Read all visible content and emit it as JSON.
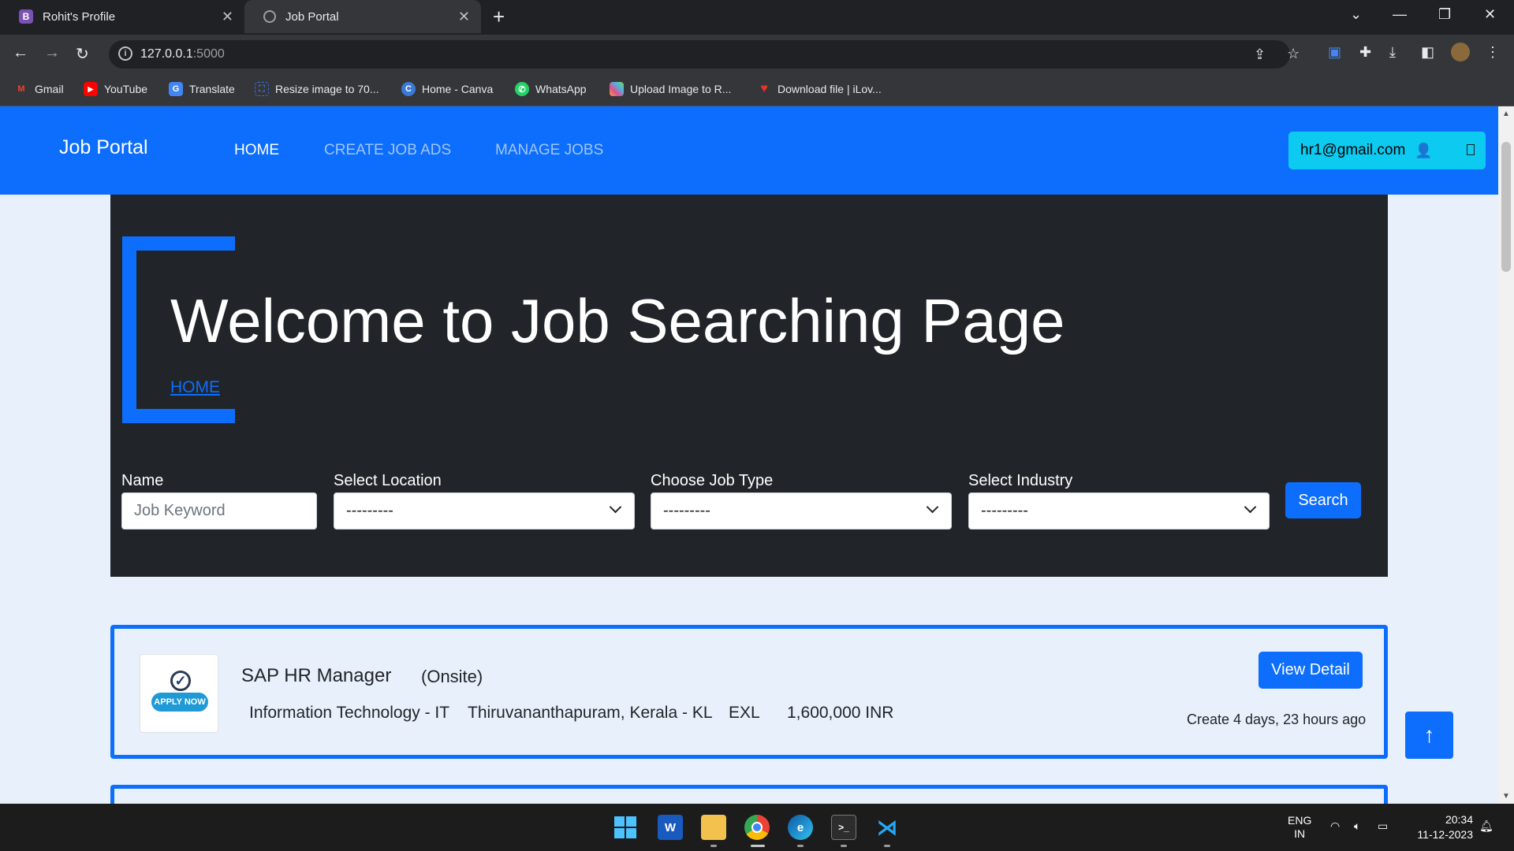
{
  "browser": {
    "tabs": [
      {
        "label": "Rohit's Profile",
        "favicon": "B"
      },
      {
        "label": "Job Portal"
      }
    ],
    "url_host": "127.0.0.1",
    "url_port": ":5000",
    "bookmarks": [
      {
        "label": "Gmail",
        "icon": "M",
        "color": "#ea4335"
      },
      {
        "label": "YouTube",
        "icon": "▶",
        "color": "#ff0000"
      },
      {
        "label": "Translate",
        "icon": "G",
        "color": "#4285f4"
      },
      {
        "label": "Resize image to 70...",
        "icon": "⛶",
        "color": "#3b6fd4"
      },
      {
        "label": "Home - Canva",
        "icon": "C",
        "color": "#3a7ad6"
      },
      {
        "label": "WhatsApp",
        "icon": "✆",
        "color": "#25d366"
      },
      {
        "label": "Upload Image to R...",
        "icon": "■",
        "color": "#f2a93b"
      },
      {
        "label": "Download file | iLov...",
        "icon": "♥",
        "color": "#e5322d"
      }
    ]
  },
  "navbar": {
    "brand": "Job Portal",
    "links": [
      "HOME",
      "CREATE JOB ADS",
      "MANAGE JOBS"
    ],
    "user": "hr1@gmail.com"
  },
  "hero": {
    "title": "Welcome to Job Searching Page",
    "breadcrumb": "HOME"
  },
  "search": {
    "name_label": "Name",
    "name_placeholder": "Job Keyword",
    "location_label": "Select Location",
    "location_value": "---------",
    "jobtype_label": "Choose Job Type",
    "jobtype_value": "---------",
    "industry_label": "Select Industry",
    "industry_value": "---------",
    "button": "Search"
  },
  "jobs": [
    {
      "logo_text": "APPLY NOW",
      "title": "SAP HR Manager",
      "mode": "(Onsite)",
      "industry": "Information Technology - IT",
      "location": "Thiruvananthapuram, Kerala - KL",
      "company": "EXL",
      "salary": "1,600,000 INR",
      "detail_button": "View Detail",
      "created": "Create 4 days, 23 hours ago"
    }
  ],
  "back_to_top": "↑",
  "taskbar": {
    "lang": "ENG",
    "region": "IN",
    "time": "20:34",
    "date": "11-12-2023"
  },
  "colors": {
    "primary": "#0d6efd",
    "hero_bg": "#212529",
    "user_button": "#0dcaf0",
    "page_bg": "#e8f0fb"
  }
}
